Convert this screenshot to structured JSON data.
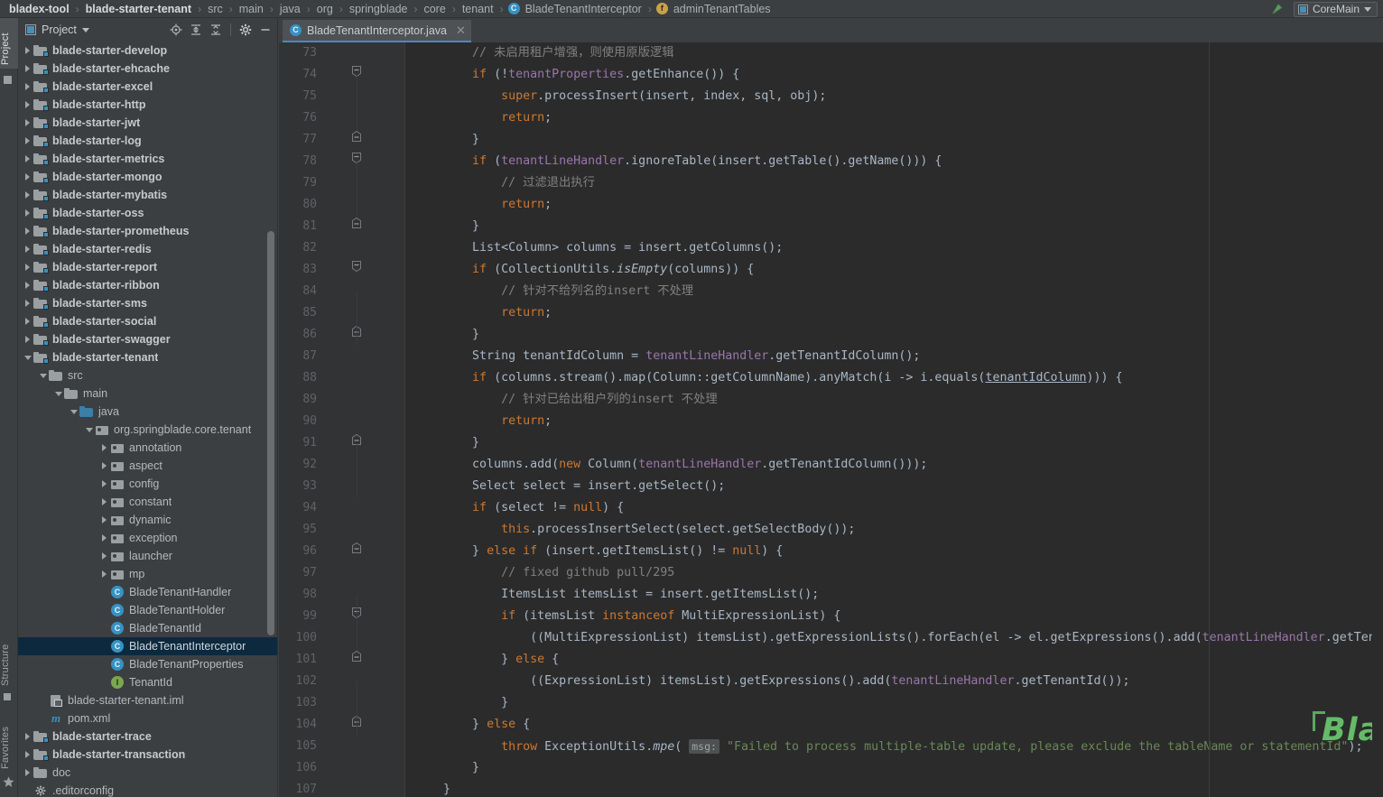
{
  "window": {
    "title": "BladeTenantInterceptor.java - bladex-tool"
  },
  "navbar": {
    "crumbs": [
      {
        "label": "bladex-tool",
        "bold": true,
        "icon": null
      },
      {
        "label": "blade-starter-tenant",
        "bold": true,
        "icon": null
      },
      {
        "label": "src",
        "bold": false,
        "icon": null
      },
      {
        "label": "main",
        "bold": false,
        "icon": null
      },
      {
        "label": "java",
        "bold": false,
        "icon": null
      },
      {
        "label": "org",
        "bold": false,
        "icon": null
      },
      {
        "label": "springblade",
        "bold": false,
        "icon": null
      },
      {
        "label": "core",
        "bold": false,
        "icon": null
      },
      {
        "label": "tenant",
        "bold": false,
        "icon": null
      },
      {
        "label": "BladeTenantInterceptor",
        "bold": false,
        "icon": "class-icon"
      },
      {
        "label": "adminTenantTables",
        "bold": false,
        "icon": "field-icon"
      }
    ],
    "separator": "›",
    "run_arrow_icon": "run-arrow-icon",
    "run_config": {
      "label": "CoreMain",
      "icon": "run-config-icon",
      "caret": "chevron-down-icon"
    }
  },
  "toolwindows": [
    {
      "label": "Project",
      "active": true
    },
    {
      "label": "Structure",
      "active": false
    },
    {
      "label": "Favorites",
      "active": false
    }
  ],
  "project_panel": {
    "title": "Project",
    "title_caret": "chevron-down-icon",
    "buttons": [
      {
        "name": "locate-icon",
        "glyph": "locate"
      },
      {
        "name": "expand-all-icon",
        "glyph": "expand"
      },
      {
        "name": "collapse-all-icon",
        "glyph": "collapse"
      },
      {
        "name": "settings-gear-icon",
        "glyph": "gear"
      },
      {
        "name": "hide-panel-icon",
        "glyph": "minus"
      }
    ],
    "tree": [
      {
        "label": "blade-starter-develop",
        "indent": 1,
        "twist": "closed",
        "icon": "module-folder",
        "bold": true
      },
      {
        "label": "blade-starter-ehcache",
        "indent": 1,
        "twist": "closed",
        "icon": "module-folder",
        "bold": true
      },
      {
        "label": "blade-starter-excel",
        "indent": 1,
        "twist": "closed",
        "icon": "module-folder",
        "bold": true
      },
      {
        "label": "blade-starter-http",
        "indent": 1,
        "twist": "closed",
        "icon": "module-folder",
        "bold": true
      },
      {
        "label": "blade-starter-jwt",
        "indent": 1,
        "twist": "closed",
        "icon": "module-folder",
        "bold": true
      },
      {
        "label": "blade-starter-log",
        "indent": 1,
        "twist": "closed",
        "icon": "module-folder",
        "bold": true
      },
      {
        "label": "blade-starter-metrics",
        "indent": 1,
        "twist": "closed",
        "icon": "module-folder",
        "bold": true
      },
      {
        "label": "blade-starter-mongo",
        "indent": 1,
        "twist": "closed",
        "icon": "module-folder",
        "bold": true
      },
      {
        "label": "blade-starter-mybatis",
        "indent": 1,
        "twist": "closed",
        "icon": "module-folder",
        "bold": true
      },
      {
        "label": "blade-starter-oss",
        "indent": 1,
        "twist": "closed",
        "icon": "module-folder",
        "bold": true
      },
      {
        "label": "blade-starter-prometheus",
        "indent": 1,
        "twist": "closed",
        "icon": "module-folder",
        "bold": true
      },
      {
        "label": "blade-starter-redis",
        "indent": 1,
        "twist": "closed",
        "icon": "module-folder",
        "bold": true
      },
      {
        "label": "blade-starter-report",
        "indent": 1,
        "twist": "closed",
        "icon": "module-folder",
        "bold": true
      },
      {
        "label": "blade-starter-ribbon",
        "indent": 1,
        "twist": "closed",
        "icon": "module-folder",
        "bold": true
      },
      {
        "label": "blade-starter-sms",
        "indent": 1,
        "twist": "closed",
        "icon": "module-folder",
        "bold": true
      },
      {
        "label": "blade-starter-social",
        "indent": 1,
        "twist": "closed",
        "icon": "module-folder",
        "bold": true
      },
      {
        "label": "blade-starter-swagger",
        "indent": 1,
        "twist": "closed",
        "icon": "module-folder",
        "bold": true
      },
      {
        "label": "blade-starter-tenant",
        "indent": 1,
        "twist": "open",
        "icon": "module-folder",
        "bold": true
      },
      {
        "label": "src",
        "indent": 2,
        "twist": "open",
        "icon": "folder",
        "bold": false
      },
      {
        "label": "main",
        "indent": 3,
        "twist": "open",
        "icon": "folder",
        "bold": false
      },
      {
        "label": "java",
        "indent": 4,
        "twist": "open",
        "icon": "source-folder",
        "bold": false
      },
      {
        "label": "org.springblade.core.tenant",
        "indent": 5,
        "twist": "open",
        "icon": "package",
        "bold": false
      },
      {
        "label": "annotation",
        "indent": 6,
        "twist": "closed",
        "icon": "package",
        "bold": false
      },
      {
        "label": "aspect",
        "indent": 6,
        "twist": "closed",
        "icon": "package",
        "bold": false
      },
      {
        "label": "config",
        "indent": 6,
        "twist": "closed",
        "icon": "package",
        "bold": false
      },
      {
        "label": "constant",
        "indent": 6,
        "twist": "closed",
        "icon": "package",
        "bold": false
      },
      {
        "label": "dynamic",
        "indent": 6,
        "twist": "closed",
        "icon": "package",
        "bold": false
      },
      {
        "label": "exception",
        "indent": 6,
        "twist": "closed",
        "icon": "package",
        "bold": false
      },
      {
        "label": "launcher",
        "indent": 6,
        "twist": "closed",
        "icon": "package",
        "bold": false
      },
      {
        "label": "mp",
        "indent": 6,
        "twist": "closed",
        "icon": "package",
        "bold": false
      },
      {
        "label": "BladeTenantHandler",
        "indent": 6,
        "twist": "none",
        "icon": "class",
        "bold": false
      },
      {
        "label": "BladeTenantHolder",
        "indent": 6,
        "twist": "none",
        "icon": "class",
        "bold": false
      },
      {
        "label": "BladeTenantId",
        "indent": 6,
        "twist": "none",
        "icon": "class",
        "bold": false
      },
      {
        "label": "BladeTenantInterceptor",
        "indent": 6,
        "twist": "none",
        "icon": "class",
        "bold": false,
        "selected": true
      },
      {
        "label": "BladeTenantProperties",
        "indent": 6,
        "twist": "none",
        "icon": "class",
        "bold": false
      },
      {
        "label": "TenantId",
        "indent": 6,
        "twist": "none",
        "icon": "annotation",
        "bold": false
      },
      {
        "label": "blade-starter-tenant.iml",
        "indent": 2,
        "twist": "none",
        "icon": "iml",
        "bold": false
      },
      {
        "label": "pom.xml",
        "indent": 2,
        "twist": "none",
        "icon": "maven",
        "bold": false
      },
      {
        "label": "blade-starter-trace",
        "indent": 1,
        "twist": "closed",
        "icon": "module-folder",
        "bold": true
      },
      {
        "label": "blade-starter-transaction",
        "indent": 1,
        "twist": "closed",
        "icon": "module-folder",
        "bold": true
      },
      {
        "label": "doc",
        "indent": 1,
        "twist": "closed",
        "icon": "folder",
        "bold": false
      },
      {
        "label": ".editorconfig",
        "indent": 1,
        "twist": "none",
        "icon": "gear-file",
        "bold": false
      }
    ]
  },
  "editor": {
    "tab": {
      "label": "BladeTenantInterceptor.java",
      "icon": "class-icon",
      "close_icon": "close-icon"
    },
    "first_line_number": 73,
    "lines": [
      {
        "n": 73,
        "fold": "none",
        "html": "        <span class=\"cmt\">// 未启用租户增强，则使用原版逻辑</span>"
      },
      {
        "n": 74,
        "fold": "minus",
        "html": "        <span class=\"kw\">if</span> (!<span class=\"fld\">tenantProperties</span>.getEnhance()) {"
      },
      {
        "n": 75,
        "fold": "none",
        "html": "            <span class=\"kw\">super</span>.processInsert(insert, index, sql, obj);"
      },
      {
        "n": 76,
        "fold": "none",
        "html": "            <span class=\"kw\">return</span>;"
      },
      {
        "n": 77,
        "fold": "end",
        "html": "        }"
      },
      {
        "n": 78,
        "fold": "minus",
        "html": "        <span class=\"kw\">if</span> (<span class=\"fld\">tenantLineHandler</span>.ignoreTable(insert.getTable().getName())) {"
      },
      {
        "n": 79,
        "fold": "none",
        "html": "            <span class=\"cmt\">// 过滤退出执行</span>"
      },
      {
        "n": 80,
        "fold": "none",
        "html": "            <span class=\"kw\">return</span>;"
      },
      {
        "n": 81,
        "fold": "end",
        "html": "        }"
      },
      {
        "n": 82,
        "fold": "none",
        "html": "        List&lt;Column&gt; columns = insert.getColumns();"
      },
      {
        "n": 83,
        "fold": "minus",
        "html": "        <span class=\"kw\">if</span> (CollectionUtils.<span class=\"it\">isEmpty</span>(columns)) {"
      },
      {
        "n": 84,
        "fold": "none",
        "html": "            <span class=\"cmt\">// 针对不给列名的insert 不处理</span>"
      },
      {
        "n": 85,
        "fold": "none",
        "html": "            <span class=\"kw\">return</span>;"
      },
      {
        "n": 86,
        "fold": "end",
        "html": "        }"
      },
      {
        "n": 87,
        "fold": "none",
        "html": "        String tenantIdColumn = <span class=\"fld\">tenantLineHandler</span>.getTenantIdColumn();"
      },
      {
        "n": 88,
        "fold": "none",
        "html": "        <span class=\"kw\">if</span> (columns.stream().map(Column::getColumnName).anyMatch(i -&gt; i.equals(<span class=\"ul\">tenantIdColumn</span>))) {"
      },
      {
        "n": 89,
        "fold": "none",
        "html": "            <span class=\"cmt\">// 针对已给出租户列的insert 不处理</span>"
      },
      {
        "n": 90,
        "fold": "none",
        "html": "            <span class=\"kw\">return</span>;"
      },
      {
        "n": 91,
        "fold": "end",
        "html": "        }"
      },
      {
        "n": 92,
        "fold": "none",
        "html": "        columns.add(<span class=\"kw\">new</span> Column(<span class=\"fld\">tenantLineHandler</span>.getTenantIdColumn()));"
      },
      {
        "n": 93,
        "fold": "none",
        "html": "        Select select = insert.getSelect();"
      },
      {
        "n": 94,
        "fold": "none",
        "html": "        <span class=\"kw\">if</span> (select != <span class=\"kw\">null</span>) {"
      },
      {
        "n": 95,
        "fold": "none",
        "html": "            <span class=\"kw\">this</span>.processInsertSelect(select.getSelectBody());"
      },
      {
        "n": 96,
        "fold": "end",
        "html": "        } <span class=\"kw\">else if</span> (insert.getItemsList() != <span class=\"kw\">null</span>) {"
      },
      {
        "n": 97,
        "fold": "none",
        "html": "            <span class=\"cmt\">// fixed github pull/295</span>"
      },
      {
        "n": 98,
        "fold": "none",
        "html": "            ItemsList itemsList = insert.getItemsList();"
      },
      {
        "n": 99,
        "fold": "minus",
        "html": "            <span class=\"kw\">if</span> (itemsList <span class=\"kw\">instanceof</span> MultiExpressionList) {"
      },
      {
        "n": 100,
        "fold": "none",
        "html": "                ((MultiExpressionList) itemsList).getExpressionLists().forEach(el -&gt; el.getExpressions().add(<span class=\"fld\">tenantLineHandler</span>.getTenantId()));"
      },
      {
        "n": 101,
        "fold": "end",
        "html": "            } <span class=\"kw\">else</span> {"
      },
      {
        "n": 102,
        "fold": "none",
        "html": "                ((ExpressionList) itemsList).getExpressions().add(<span class=\"fld\">tenantLineHandler</span>.getTenantId());"
      },
      {
        "n": 103,
        "fold": "none",
        "html": "            }"
      },
      {
        "n": 104,
        "fold": "end",
        "html": "        } <span class=\"kw\">else</span> {"
      },
      {
        "n": 105,
        "fold": "none",
        "html": "            <span class=\"kw\">throw</span> ExceptionUtils.<span class=\"it\">mpe</span>( <span class=\"hintpill\">msg:</span> <span class=\"str\">\"Failed to process multiple-table update, please exclude the tableName or statementId\"</span>);"
      },
      {
        "n": 106,
        "fold": "none",
        "html": "        }"
      },
      {
        "n": 107,
        "fold": "none",
        "html": "    }"
      }
    ],
    "watermark": "Blade技术社区"
  },
  "colors": {
    "accent": "#4a88c7",
    "editor_bg": "#2b2b2b",
    "gutter_bg": "#313335",
    "panel_bg": "#3c3f41",
    "selection_bg": "#0d293e",
    "keyword": "#cc7832",
    "field": "#9876aa",
    "string": "#6a8759",
    "comment": "#808080",
    "default_text": "#a9b7c6",
    "watermark_green": "#66bb6a"
  }
}
